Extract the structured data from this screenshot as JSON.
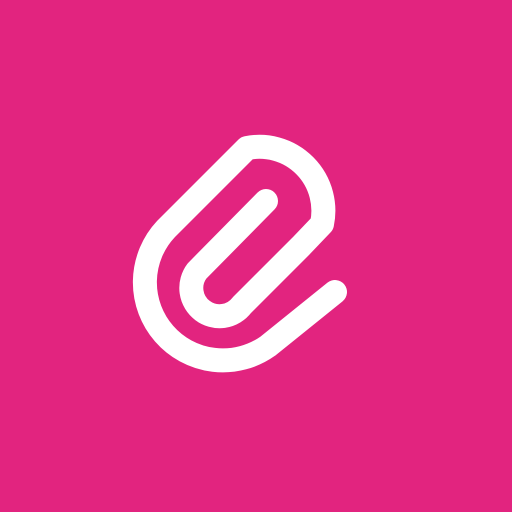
{
  "app_icon": {
    "icon": "paperclip-icon",
    "background_color": "#e2247f",
    "glyph_color": "#ffffff"
  }
}
